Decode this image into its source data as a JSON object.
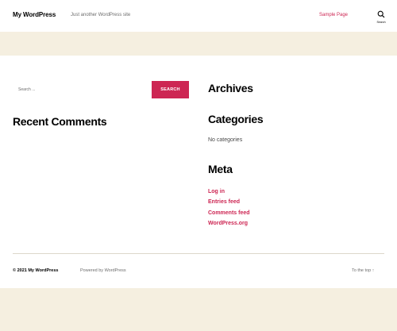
{
  "header": {
    "site_title": "My WordPress",
    "site_description": "Just another WordPress site",
    "nav": {
      "sample_page": "Sample Page"
    },
    "search_toggle": {
      "icon": "search-icon",
      "label": "Search"
    }
  },
  "search_widget": {
    "placeholder": "Search ...",
    "button_label": "SEARCH"
  },
  "widgets": {
    "recent_comments_title": "Recent Comments",
    "archives_title": "Archives",
    "categories_title": "Categories",
    "categories_empty": "No categories",
    "meta_title": "Meta",
    "meta_links": [
      "Log in",
      "Entries feed",
      "Comments feed",
      "WordPress.org"
    ]
  },
  "footer": {
    "copyright": "© 2021 My WordPress",
    "powered_by": "Powered by WordPress",
    "to_top": "To the top ↑"
  },
  "colors": {
    "accent": "#cd2653",
    "band": "#f5efe0",
    "divider": "#dcd7ca"
  }
}
